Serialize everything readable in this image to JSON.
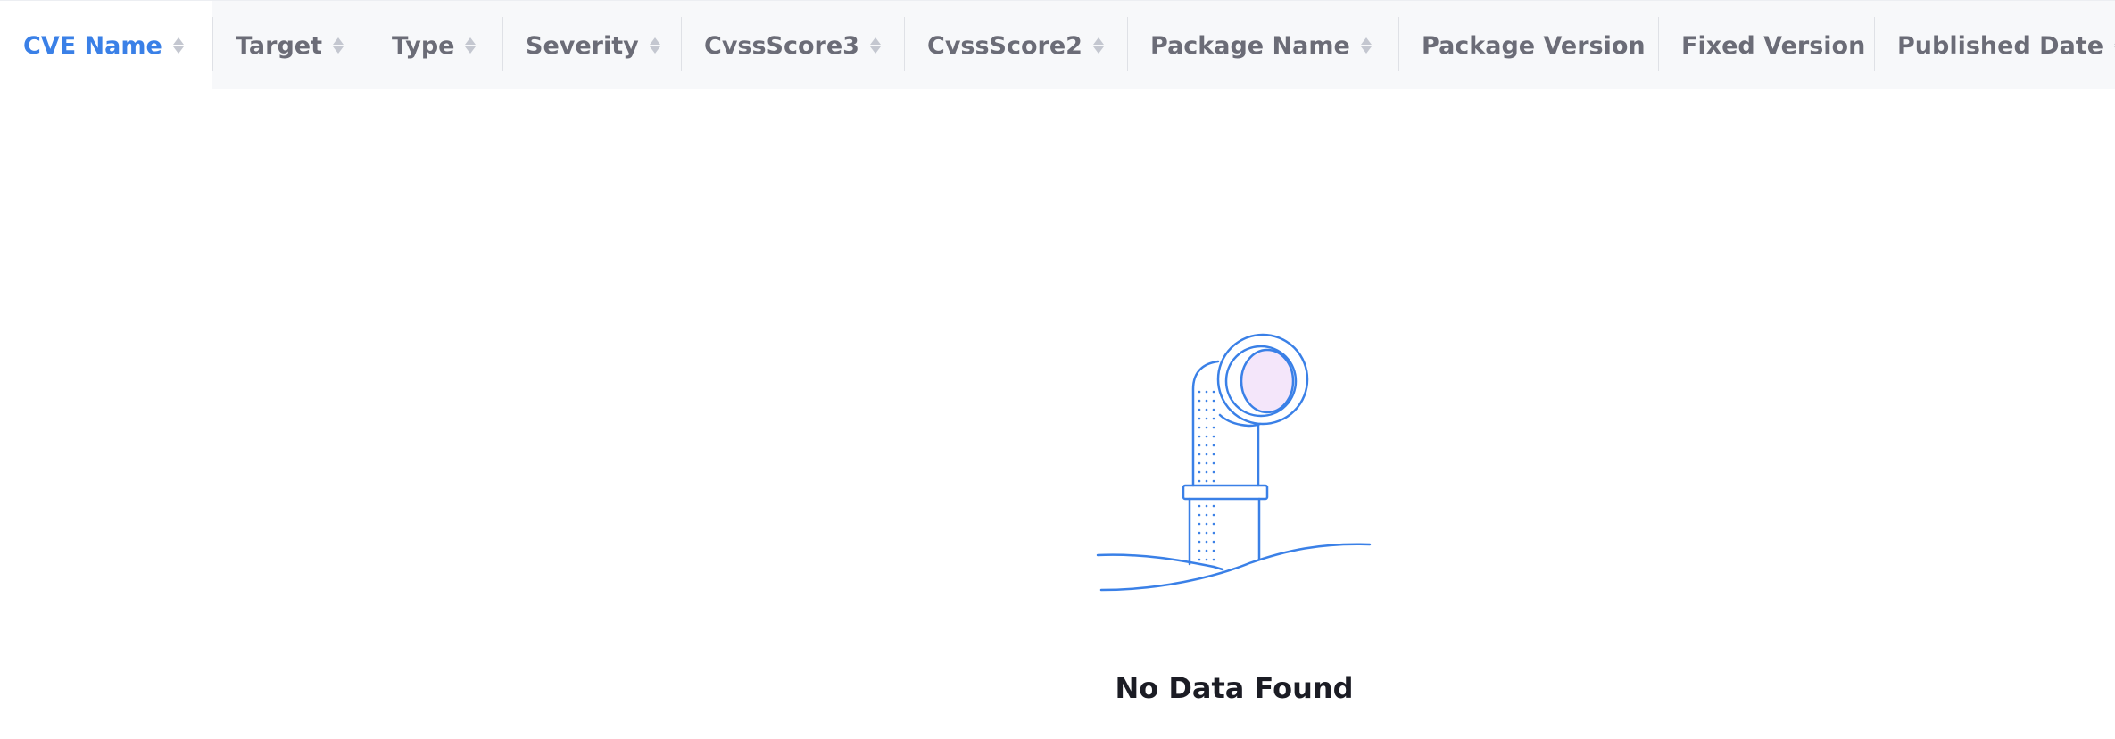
{
  "table": {
    "columns": [
      {
        "label": "CVE Name",
        "sortable": true,
        "active": true
      },
      {
        "label": "Target",
        "sortable": true,
        "active": false
      },
      {
        "label": "Type",
        "sortable": true,
        "active": false
      },
      {
        "label": "Severity",
        "sortable": true,
        "active": false
      },
      {
        "label": "CvssScore3",
        "sortable": true,
        "active": false
      },
      {
        "label": "CvssScore2",
        "sortable": true,
        "active": false
      },
      {
        "label": "Package Name",
        "sortable": true,
        "active": false
      },
      {
        "label": "Package Version",
        "sortable": false,
        "active": false
      },
      {
        "label": "Fixed Version",
        "sortable": false,
        "active": false
      },
      {
        "label": "Published Date",
        "sortable": true,
        "active": false
      }
    ]
  },
  "empty_state": {
    "message": "No Data Found",
    "icon": "periscope-icon"
  },
  "colors": {
    "accent": "#3a80e7",
    "header_bg": "#f7f8fa",
    "header_text": "#6b6c77",
    "empty_text": "#1b1c24",
    "lens_fill": "#f4e6fa"
  }
}
